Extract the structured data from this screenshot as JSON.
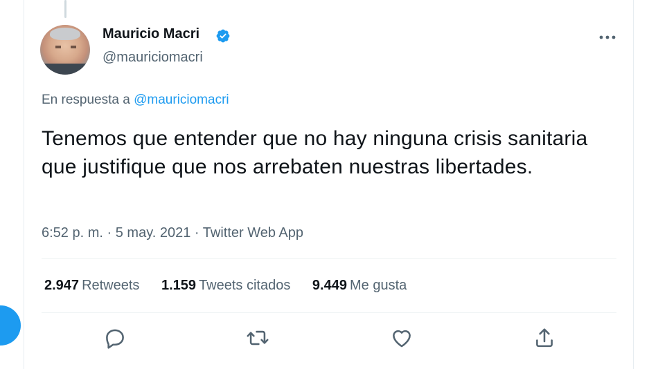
{
  "tweet": {
    "author": {
      "display_name": "Mauricio Macri",
      "handle": "@mauriciomacri",
      "verified": true
    },
    "reply_prefix": "En respuesta a",
    "reply_to": "@mauriciomacri",
    "text": "Tenemos que entender que no hay ninguna crisis sanitaria que justifique que nos arrebaten nuestras libertades.",
    "time": "6:52 p. m.",
    "date": "5 may. 2021",
    "source": "Twitter Web App",
    "separator": "·"
  },
  "stats": {
    "retweets": {
      "count": "2.947",
      "label": "Retweets"
    },
    "quotes": {
      "count": "1.159",
      "label": "Tweets citados"
    },
    "likes": {
      "count": "9.449",
      "label": "Me gusta"
    }
  },
  "actions": [
    {
      "icon": "reply-icon"
    },
    {
      "icon": "retweet-icon"
    },
    {
      "icon": "like-icon"
    },
    {
      "icon": "share-icon"
    }
  ],
  "colors": {
    "accent": "#1d9bf0",
    "text_primary": "#0f1419",
    "text_secondary": "#536471",
    "divider": "#eff3f4"
  }
}
